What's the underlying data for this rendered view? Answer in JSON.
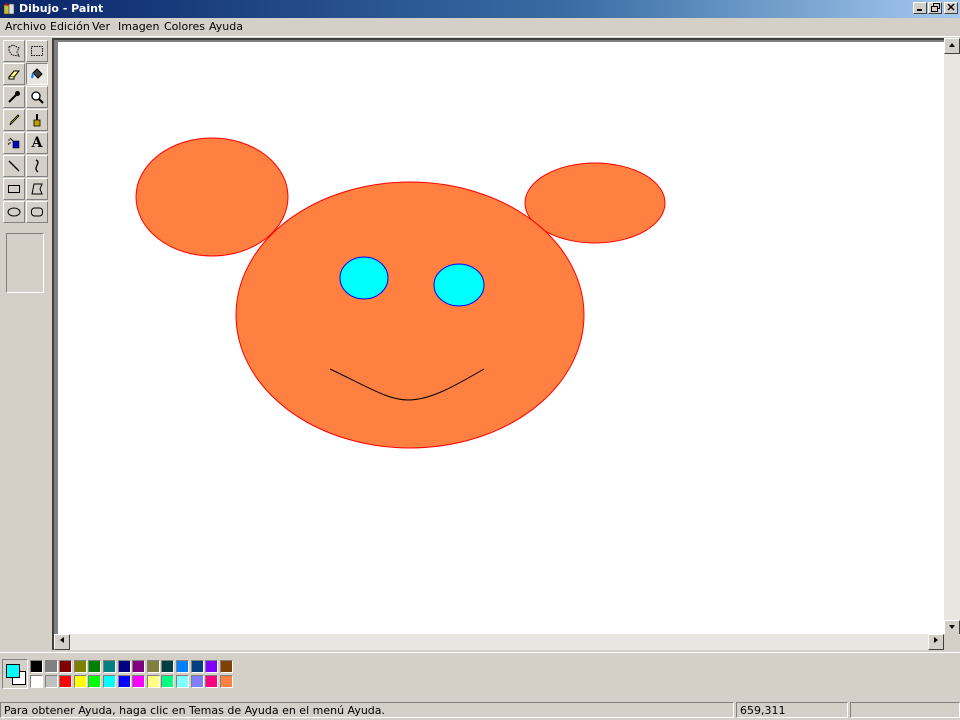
{
  "window": {
    "title": "Dibujo - Paint"
  },
  "menu": [
    "Archivo",
    "Edición",
    "Ver",
    "Imagen",
    "Colores",
    "Ayuda"
  ],
  "tools": [
    {
      "name": "free-form-select-icon"
    },
    {
      "name": "select-icon"
    },
    {
      "name": "eraser-icon"
    },
    {
      "name": "fill-bucket-icon"
    },
    {
      "name": "pick-color-icon"
    },
    {
      "name": "magnifier-icon"
    },
    {
      "name": "pencil-icon"
    },
    {
      "name": "brush-icon"
    },
    {
      "name": "airbrush-icon"
    },
    {
      "name": "text-icon",
      "label": "A"
    },
    {
      "name": "line-icon"
    },
    {
      "name": "curve-icon"
    },
    {
      "name": "rectangle-icon"
    },
    {
      "name": "polygon-icon"
    },
    {
      "name": "ellipse-icon"
    },
    {
      "name": "rounded-rectangle-icon"
    }
  ],
  "active_tool": "fill-bucket-icon",
  "colors": {
    "foreground": "#00ffff",
    "background": "#ffffff",
    "face_fill": "#ff8040",
    "face_outline": "#ff0000",
    "eye_fill": "#00ffff",
    "eye_outline": "#0000ff",
    "mouth": "#000000"
  },
  "palette": {
    "top": [
      "#000000",
      "#808080",
      "#800000",
      "#808000",
      "#008000",
      "#008080",
      "#000080",
      "#800080",
      "#808040",
      "#004040",
      "#0080ff",
      "#004080",
      "#8000ff",
      "#804000"
    ],
    "bottom": [
      "#ffffff",
      "#c0c0c0",
      "#ff0000",
      "#ffff00",
      "#00ff00",
      "#00ffff",
      "#0000ff",
      "#ff00ff",
      "#ffff80",
      "#00ff80",
      "#80ffff",
      "#8080ff",
      "#ff0080",
      "#ff8040"
    ]
  },
  "status": {
    "help": "Para obtener Ayuda, haga clic en Temas de Ayuda en el menú Ayuda.",
    "coords": "659,311",
    "size": ""
  }
}
